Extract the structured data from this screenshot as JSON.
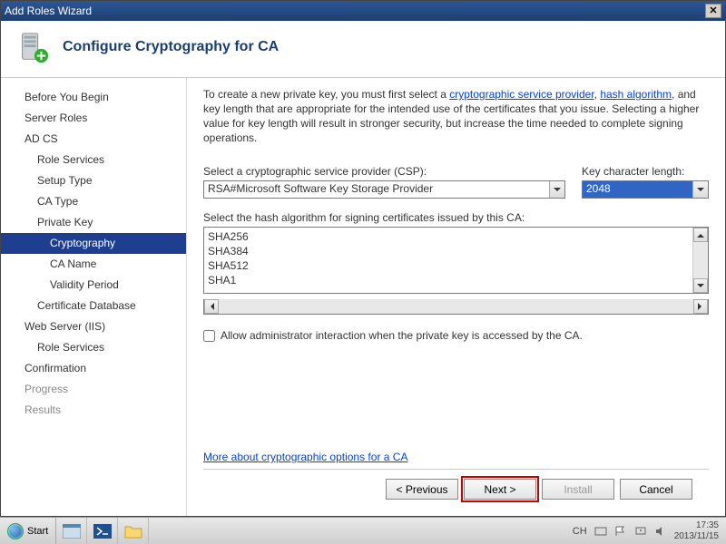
{
  "window": {
    "title": "Add Roles Wizard"
  },
  "header": {
    "title": "Configure Cryptography for CA"
  },
  "sidebar": {
    "items": [
      {
        "label": "Before You Begin",
        "level": 1
      },
      {
        "label": "Server Roles",
        "level": 1
      },
      {
        "label": "AD CS",
        "level": 1
      },
      {
        "label": "Role Services",
        "level": 2
      },
      {
        "label": "Setup Type",
        "level": 2
      },
      {
        "label": "CA Type",
        "level": 2
      },
      {
        "label": "Private Key",
        "level": 2
      },
      {
        "label": "Cryptography",
        "level": 3,
        "selected": true
      },
      {
        "label": "CA Name",
        "level": 3
      },
      {
        "label": "Validity Period",
        "level": 3
      },
      {
        "label": "Certificate Database",
        "level": 2
      },
      {
        "label": "Web Server (IIS)",
        "level": 1
      },
      {
        "label": "Role Services",
        "level": 2
      },
      {
        "label": "Confirmation",
        "level": 1
      },
      {
        "label": "Progress",
        "level": 1,
        "dim": true
      },
      {
        "label": "Results",
        "level": 1,
        "dim": true
      }
    ]
  },
  "content": {
    "intro_pre": "To create a new private key, you must first select a ",
    "link_csp": "cryptographic service provider",
    "intro_mid": ", ",
    "link_hash": "hash algorithm",
    "intro_post": ", and key length that are appropriate for the intended use of the certificates that you issue. Selecting a higher value for key length will result in stronger security, but increase the time needed to complete signing operations.",
    "csp_label": "Select a cryptographic service provider (CSP):",
    "csp_value": "RSA#Microsoft Software Key Storage Provider",
    "keylen_label": "Key character length:",
    "keylen_value": "2048",
    "hash_label": "Select the hash algorithm for signing certificates issued by this CA:",
    "hash_options": [
      "SHA256",
      "SHA384",
      "SHA512",
      "SHA1"
    ],
    "checkbox_label": "Allow administrator interaction when the private key is accessed by the CA.",
    "more_link": "More about cryptographic options for a CA"
  },
  "footer": {
    "previous": "< Previous",
    "next": "Next >",
    "install": "Install",
    "cancel": "Cancel"
  },
  "taskbar": {
    "start": "Start",
    "lang": "CH",
    "time": "17:35",
    "date": "2013/11/15"
  }
}
